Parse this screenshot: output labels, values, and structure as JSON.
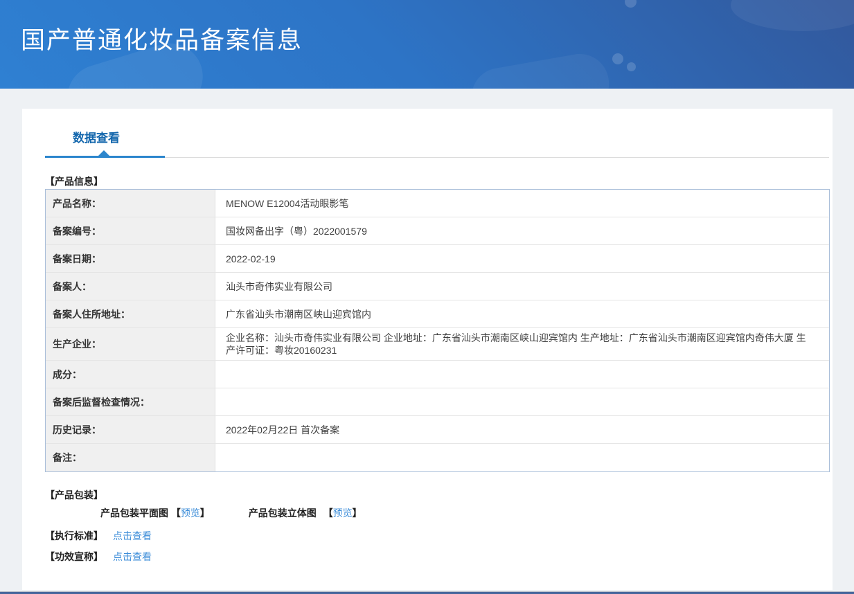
{
  "header": {
    "title": "国产普通化妆品备案信息"
  },
  "tab": {
    "label": "数据查看"
  },
  "product_info": {
    "section_title": "【产品信息】",
    "rows": [
      {
        "label": "产品名称：",
        "value": "MENOW E12004活动眼影笔"
      },
      {
        "label": "备案编号：",
        "value": "国妆网备出字（粤）2022001579"
      },
      {
        "label": "备案日期：",
        "value": "2022-02-19"
      },
      {
        "label": "备案人：",
        "value": "汕头市奇伟实业有限公司"
      },
      {
        "label": "备案人住所地址：",
        "value": "广东省汕头市潮南区峡山迎宾馆内"
      },
      {
        "label": "生产企业：",
        "value": "企业名称：汕头市奇伟实业有限公司 企业地址：广东省汕头市潮南区峡山迎宾馆内 生产地址：广东省汕头市潮南区迎宾馆内奇伟大厦 生产许可证：粤妆20160231"
      },
      {
        "label": "成分：",
        "value": ""
      },
      {
        "label": "备案后监督检查情况：",
        "value": ""
      },
      {
        "label": "历史记录：",
        "value": "2022年02月22日 首次备案"
      },
      {
        "label": "备注：",
        "value": ""
      }
    ]
  },
  "packaging": {
    "section_title": "【产品包装】",
    "items": [
      {
        "label": "产品包装平面图",
        "bracket_open": "【",
        "link": "预览",
        "bracket_close": "】"
      },
      {
        "label": "产品包装立体图",
        "bracket_open": "【",
        "link": "预览",
        "bracket_close": "】"
      }
    ]
  },
  "standards": {
    "section_title": "【执行标准】",
    "link": "点击查看"
  },
  "efficacy": {
    "section_title": "【功效宣称】",
    "link": "点击查看"
  },
  "colors": {
    "banner_gradient_dark": "#32589c",
    "banner_gradient_light": "#2f80d2",
    "tab_text": "#1467ad",
    "tab_underline": "#2c86cd",
    "link": "#3e8ed9",
    "table_border": "#a9bed9",
    "label_cell_bg": "#f0f0f0",
    "footer_bar": "#48679c"
  }
}
